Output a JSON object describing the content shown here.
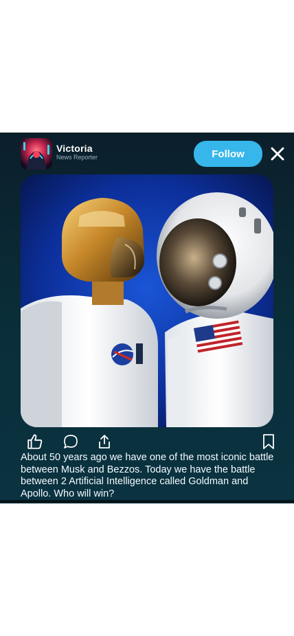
{
  "post": {
    "author_name": "Victoria",
    "author_role": "News Reporter",
    "follow_label": "Follow",
    "caption": "About 50 years ago we have one of the most iconic battle between Musk and Bezzos. Today we have the battle between 2 Artificial Intelligence called Goldman and Apollo. Who will win?"
  },
  "icons": {
    "close": "close-icon",
    "like": "thumbs-up-icon",
    "comment": "comment-icon",
    "share": "share-icon",
    "bookmark": "bookmark-icon"
  },
  "colors": {
    "card_background": "#0b2a36",
    "follow_button": "#36b6ea",
    "text_primary": "#ffffff",
    "text_secondary": "#9bb3bf"
  }
}
